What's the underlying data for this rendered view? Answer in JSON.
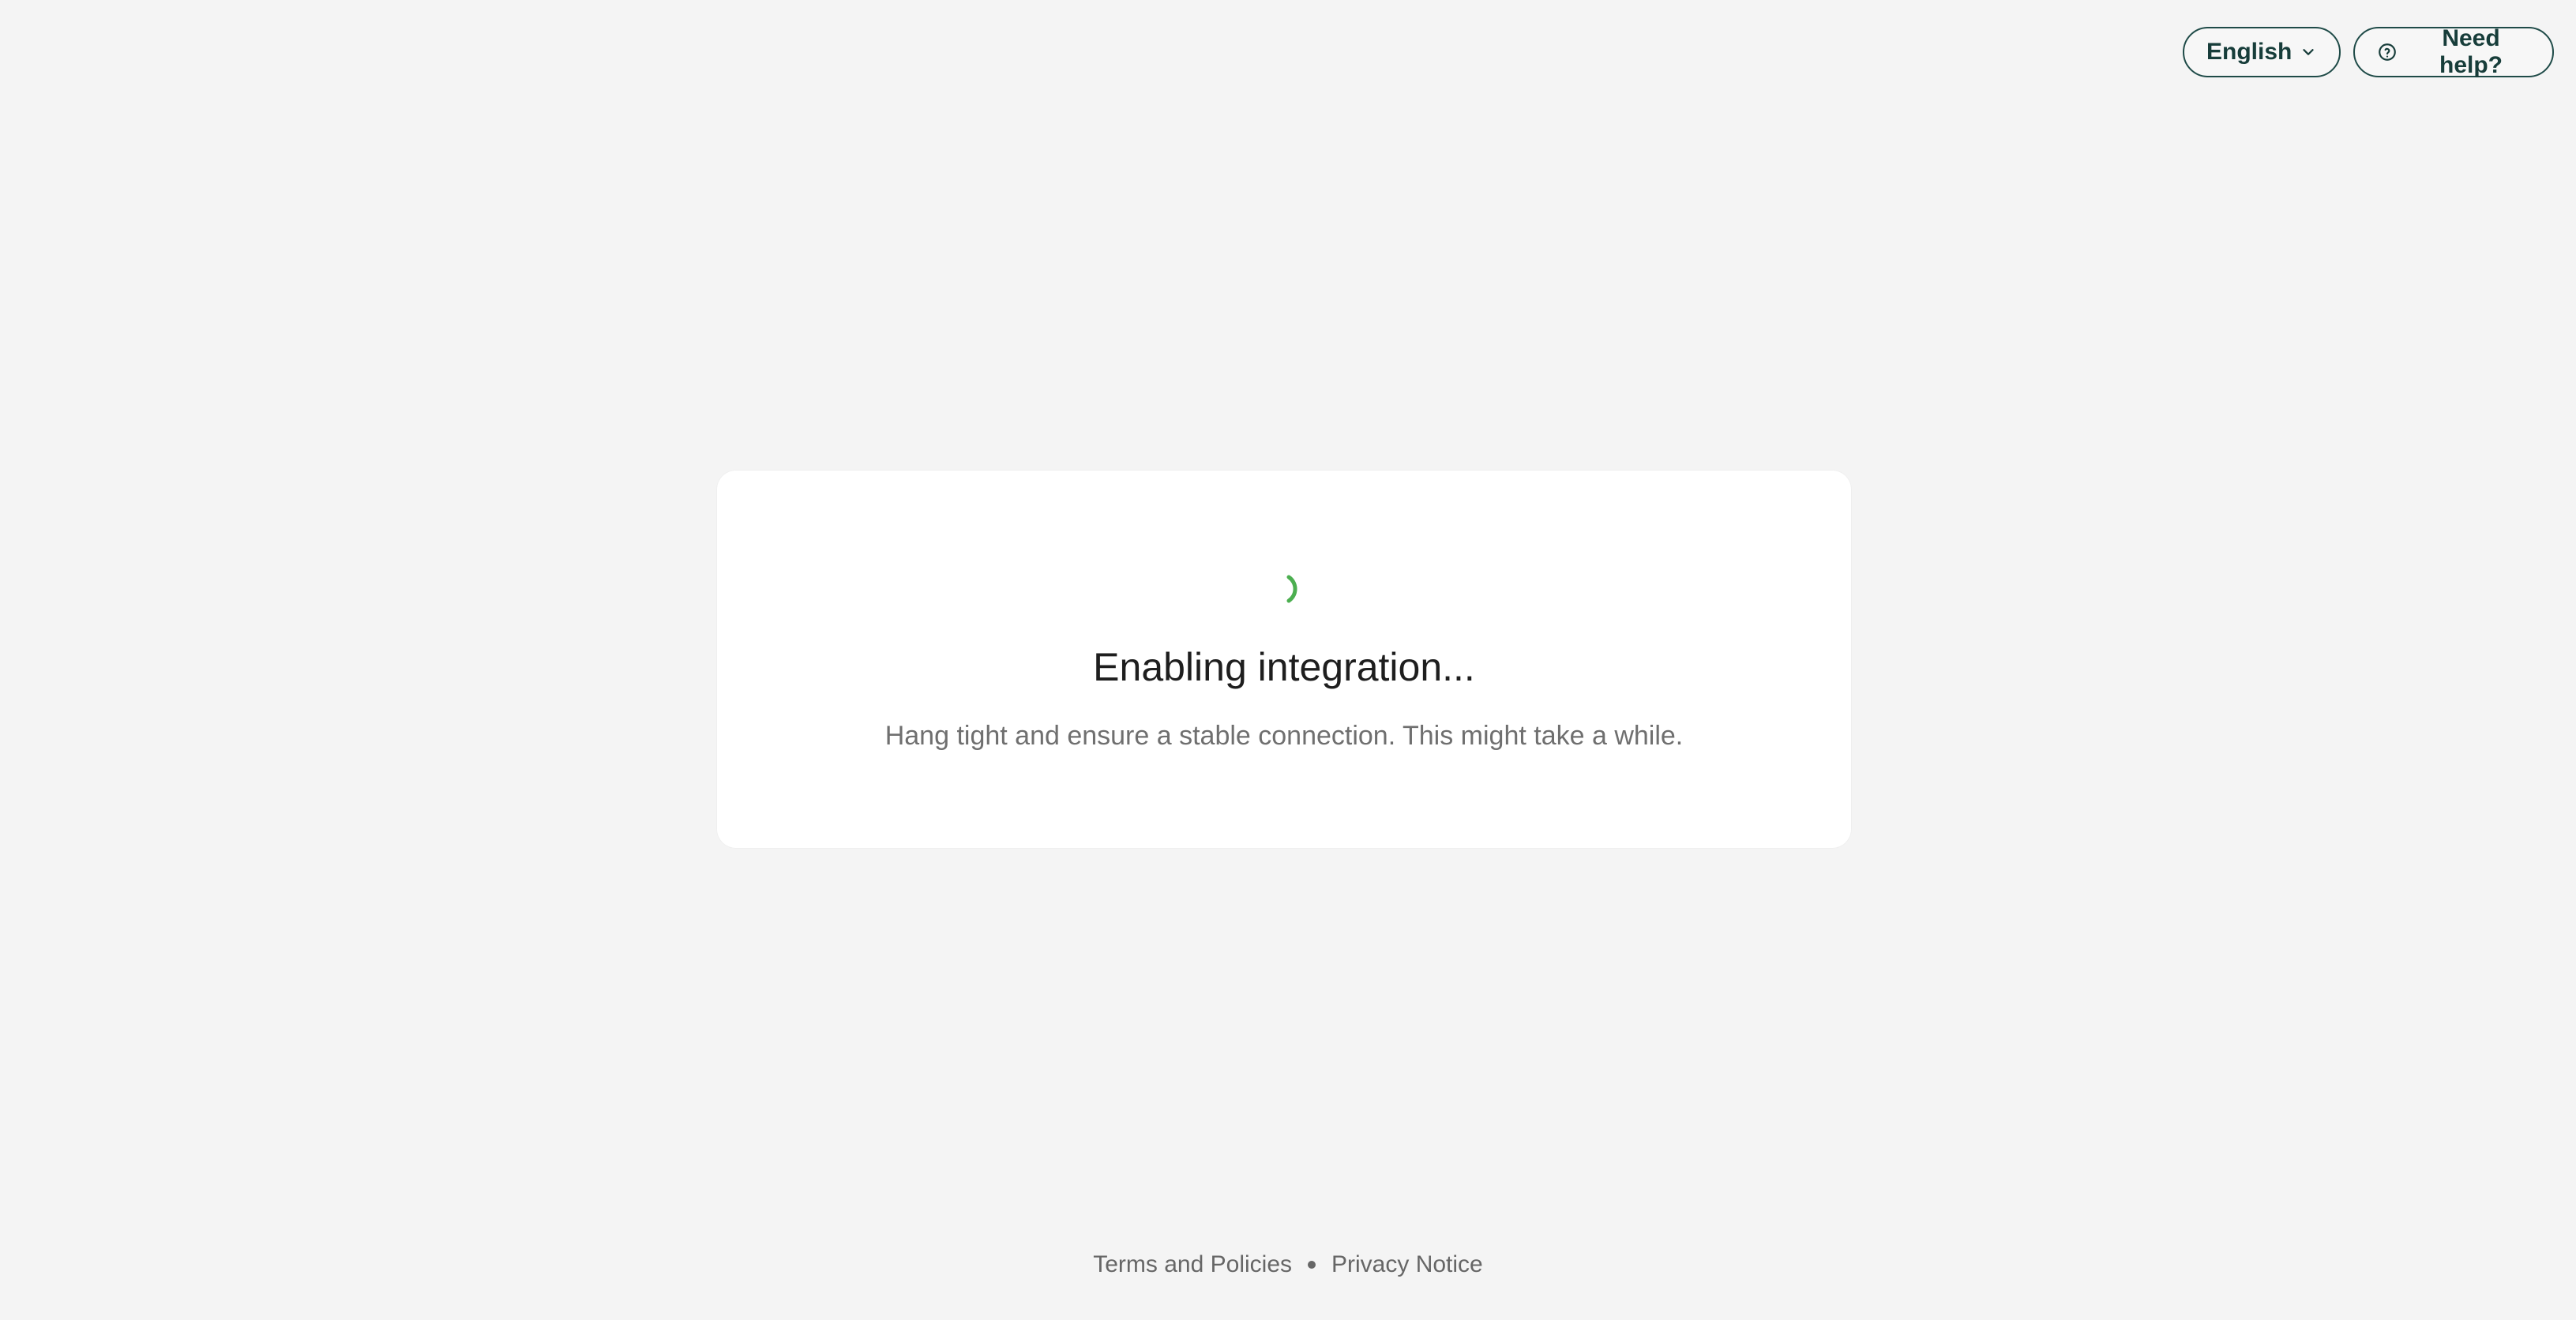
{
  "top_actions": {
    "language_button": {
      "label": "English",
      "icon": "chevron-down-icon"
    },
    "help_button": {
      "label": "Need help?",
      "icon": "help-circle-icon"
    }
  },
  "loading_card": {
    "title": "Enabling integration...",
    "subtitle": "Hang tight and ensure a stable connection. This might take a while.",
    "spinner_color": "#4caf50",
    "icon": "loading-spinner-icon"
  },
  "footer": {
    "terms_label": "Terms and Policies",
    "privacy_label": "Privacy Notice"
  },
  "colors": {
    "background": "#f4f4f4",
    "card": "#ffffff",
    "button_border": "#1f4b48",
    "text_primary": "#1e1e1e",
    "text_secondary": "#6f6f6f"
  }
}
